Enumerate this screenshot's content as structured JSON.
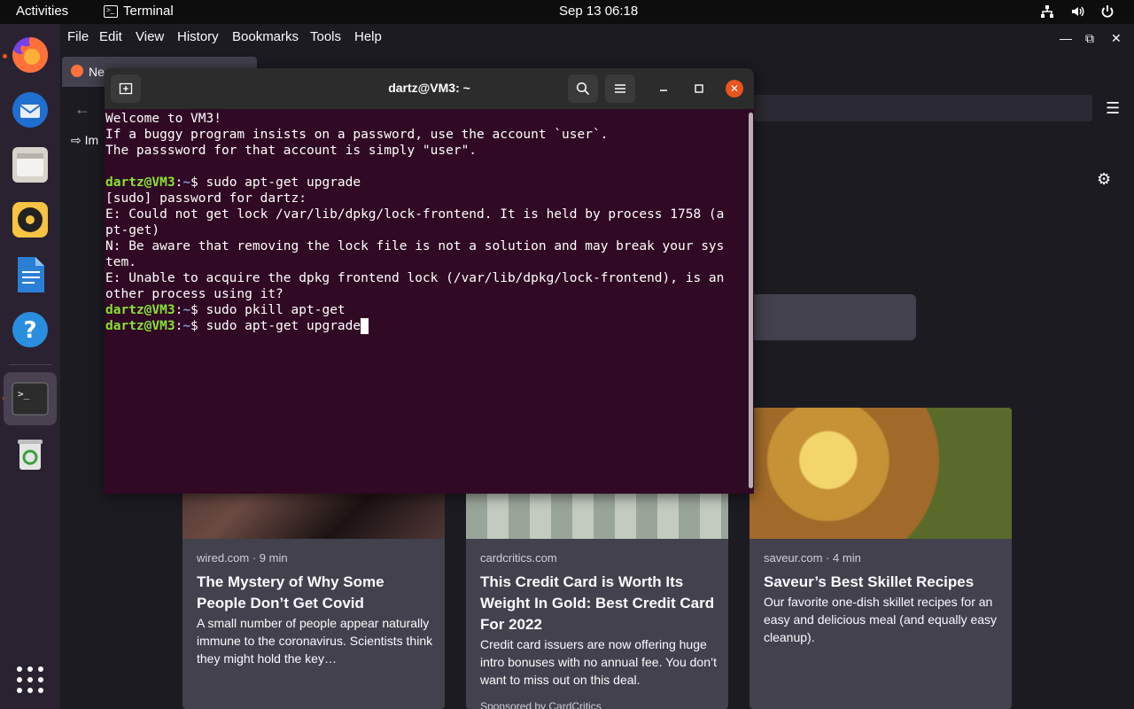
{
  "topbar": {
    "activities": "Activities",
    "app_name": "Terminal",
    "clock": "Sep 13  06:18",
    "tray_icons": [
      "network-icon",
      "volume-icon",
      "power-icon"
    ]
  },
  "dock": {
    "items": [
      {
        "name": "firefox",
        "running": true
      },
      {
        "name": "thunderbird",
        "running": false
      },
      {
        "name": "files",
        "running": false
      },
      {
        "name": "rhythmbox",
        "running": false
      },
      {
        "name": "libreoffice-writer",
        "running": false
      },
      {
        "name": "help",
        "running": false
      },
      {
        "name": "terminal",
        "running": true,
        "active": true
      },
      {
        "name": "trash",
        "running": false
      },
      {
        "name": "show-applications",
        "running": false
      }
    ]
  },
  "firefox": {
    "menu": [
      "File",
      "Edit",
      "View",
      "History",
      "Bookmarks",
      "Tools",
      "Help"
    ],
    "tab_title": "Ne",
    "import_label": "Im",
    "cards": [
      {
        "source": "wired.com · 9 min",
        "title": "The Mystery of Why Some People Don’t Get Covid",
        "description": "A small number of people appear naturally immune to the coronavirus. Scientists think they might hold the key…",
        "sponsored": ""
      },
      {
        "source": "cardcritics.com",
        "title": "This Credit Card is Worth Its Weight In Gold: Best Credit Card For 2022",
        "description": "Credit card issuers are now offering huge intro bonuses with no annual fee. You don’t want to miss out on this deal.",
        "sponsored": "Sponsored by CardCritics"
      },
      {
        "source": "saveur.com · 4 min",
        "title": "Saveur’s Best Skillet Recipes",
        "description": "Our favorite one-dish skillet recipes for an easy and delicious meal (and equally easy cleanup).",
        "sponsored": ""
      }
    ]
  },
  "terminal": {
    "title": "dartz@VM3: ~",
    "lines": [
      {
        "type": "text",
        "text": "Welcome to VM3!"
      },
      {
        "type": "text",
        "text": "If a buggy program insists on a password, use the account `user`."
      },
      {
        "type": "text",
        "text": "The passsword for that account is simply \"user\"."
      },
      {
        "type": "text",
        "text": ""
      },
      {
        "type": "prompt",
        "user": "dartz@VM3",
        "path": "~",
        "cmd": "sudo apt-get upgrade"
      },
      {
        "type": "text",
        "text": "[sudo] password for dartz:"
      },
      {
        "type": "text",
        "text": "E: Could not get lock /var/lib/dpkg/lock-frontend. It is held by process 1758 (a"
      },
      {
        "type": "text",
        "text": "pt-get)"
      },
      {
        "type": "text",
        "text": "N: Be aware that removing the lock file is not a solution and may break your sys"
      },
      {
        "type": "text",
        "text": "tem."
      },
      {
        "type": "text",
        "text": "E: Unable to acquire the dpkg frontend lock (/var/lib/dpkg/lock-frontend), is an"
      },
      {
        "type": "text",
        "text": "other process using it?"
      },
      {
        "type": "prompt",
        "user": "dartz@VM3",
        "path": "~",
        "cmd": "sudo pkill apt-get"
      },
      {
        "type": "prompt",
        "user": "dartz@VM3",
        "path": "~",
        "cmd": "sudo apt-get upgrade",
        "cursor": true
      }
    ]
  },
  "colors": {
    "terminal_bg": "#300a24",
    "prompt_user": "#8ae234",
    "prompt_path": "#729fcf",
    "accent": "#e95420"
  }
}
